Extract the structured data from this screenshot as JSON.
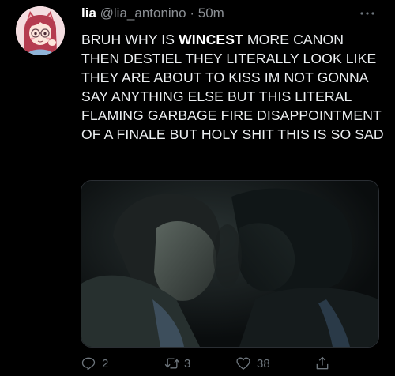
{
  "tweet": {
    "display_name": "lia",
    "handle": "@lia_antonino",
    "separator": "·",
    "time": "50m",
    "text_parts": [
      "BRUH WHY IS ",
      "WINCEST",
      " MORE CANON THEN DESTIEL THEY LITERALLY LOOK LIKE THEY ARE ABOUT TO KISS IM NOT GONNA SAY ANYTHING ELSE BUT THIS LITERAL FLAMING GARBAGE FIRE DISAPPOINTMENT OF A FINALE BUT HOLY SHIT THIS IS SO SAD"
    ],
    "more_icon": "more-horizontal-icon"
  },
  "actions": {
    "reply": {
      "icon": "reply-icon",
      "count": "2"
    },
    "retweet": {
      "icon": "retweet-icon",
      "count": "3"
    },
    "like": {
      "icon": "heart-icon",
      "count": "38"
    },
    "share": {
      "icon": "share-icon"
    }
  },
  "colors": {
    "background": "#000000",
    "text": "#e7e9ea",
    "secondary": "#8b8f94",
    "icon": "#6e767d",
    "media_border": "#2a2e33"
  }
}
